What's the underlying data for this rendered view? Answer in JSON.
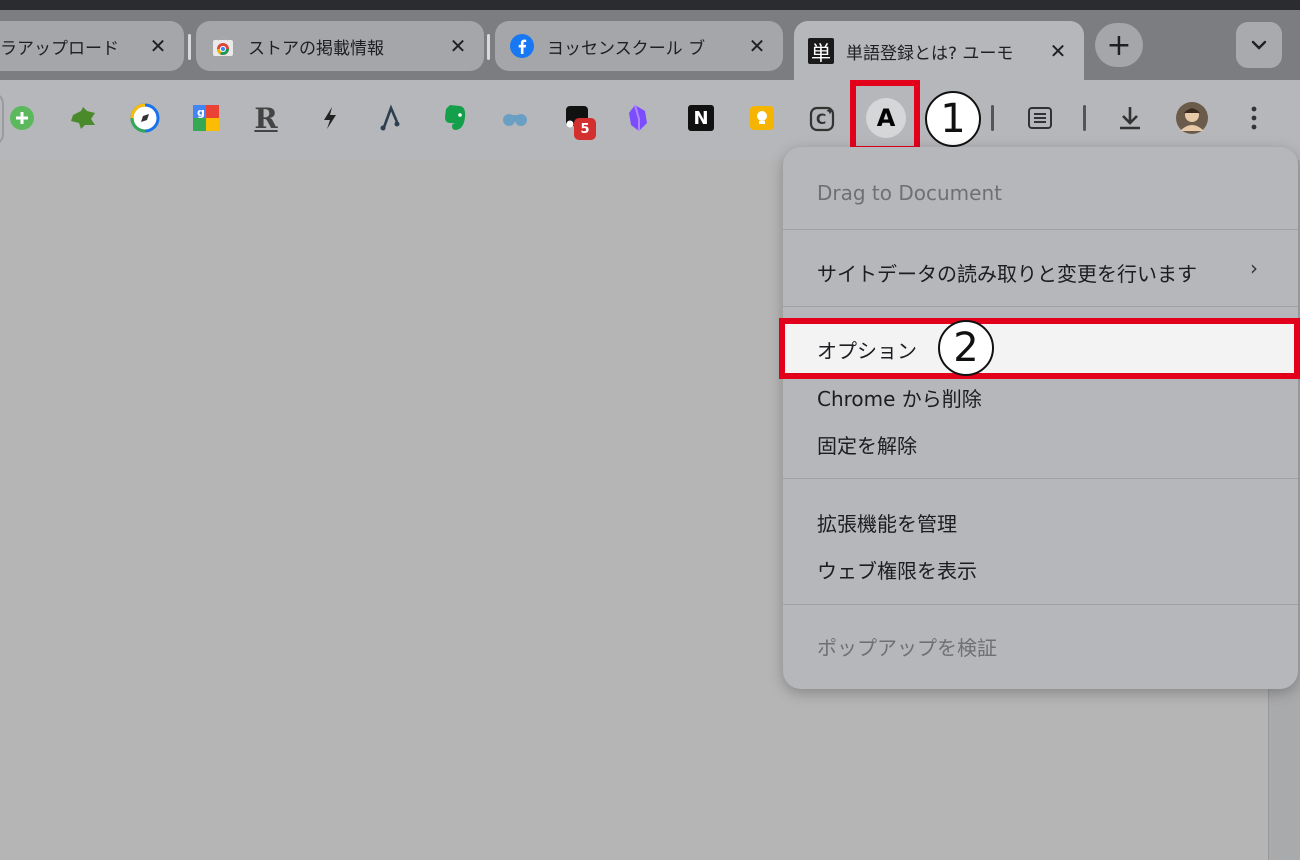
{
  "tabs": [
    {
      "title": "ラアップロード",
      "close": "✕"
    },
    {
      "title": "ストアの掲載情報",
      "close": "✕"
    },
    {
      "title": "ヨッセンスクール ブ",
      "close": "✕"
    },
    {
      "title": "単語登録とは? ユーモ",
      "close": "✕",
      "favicon_text": "単"
    }
  ],
  "newtab_label": "+",
  "tabsearch_label": "⌄",
  "extensions": {
    "badge_count": "5",
    "notion_letter": "N",
    "rakuten_letter": "R",
    "active_ext_letter": "A"
  },
  "annotations": {
    "step1": "1",
    "step2": "2"
  },
  "context_menu": {
    "header": "Drag to Document",
    "site_data": "サイトデータの読み取りと変更を行います",
    "site_data_chevron": "›",
    "options": "オプション",
    "remove": "Chrome から削除",
    "unpin": "固定を解除",
    "manage": "拡張機能を管理",
    "permissions": "ウェブ権限を表示",
    "inspect_popup": "ポップアップを検証"
  },
  "colors": {
    "highlight": "#e3001b",
    "accent_red_badge": "#d32f2f"
  }
}
